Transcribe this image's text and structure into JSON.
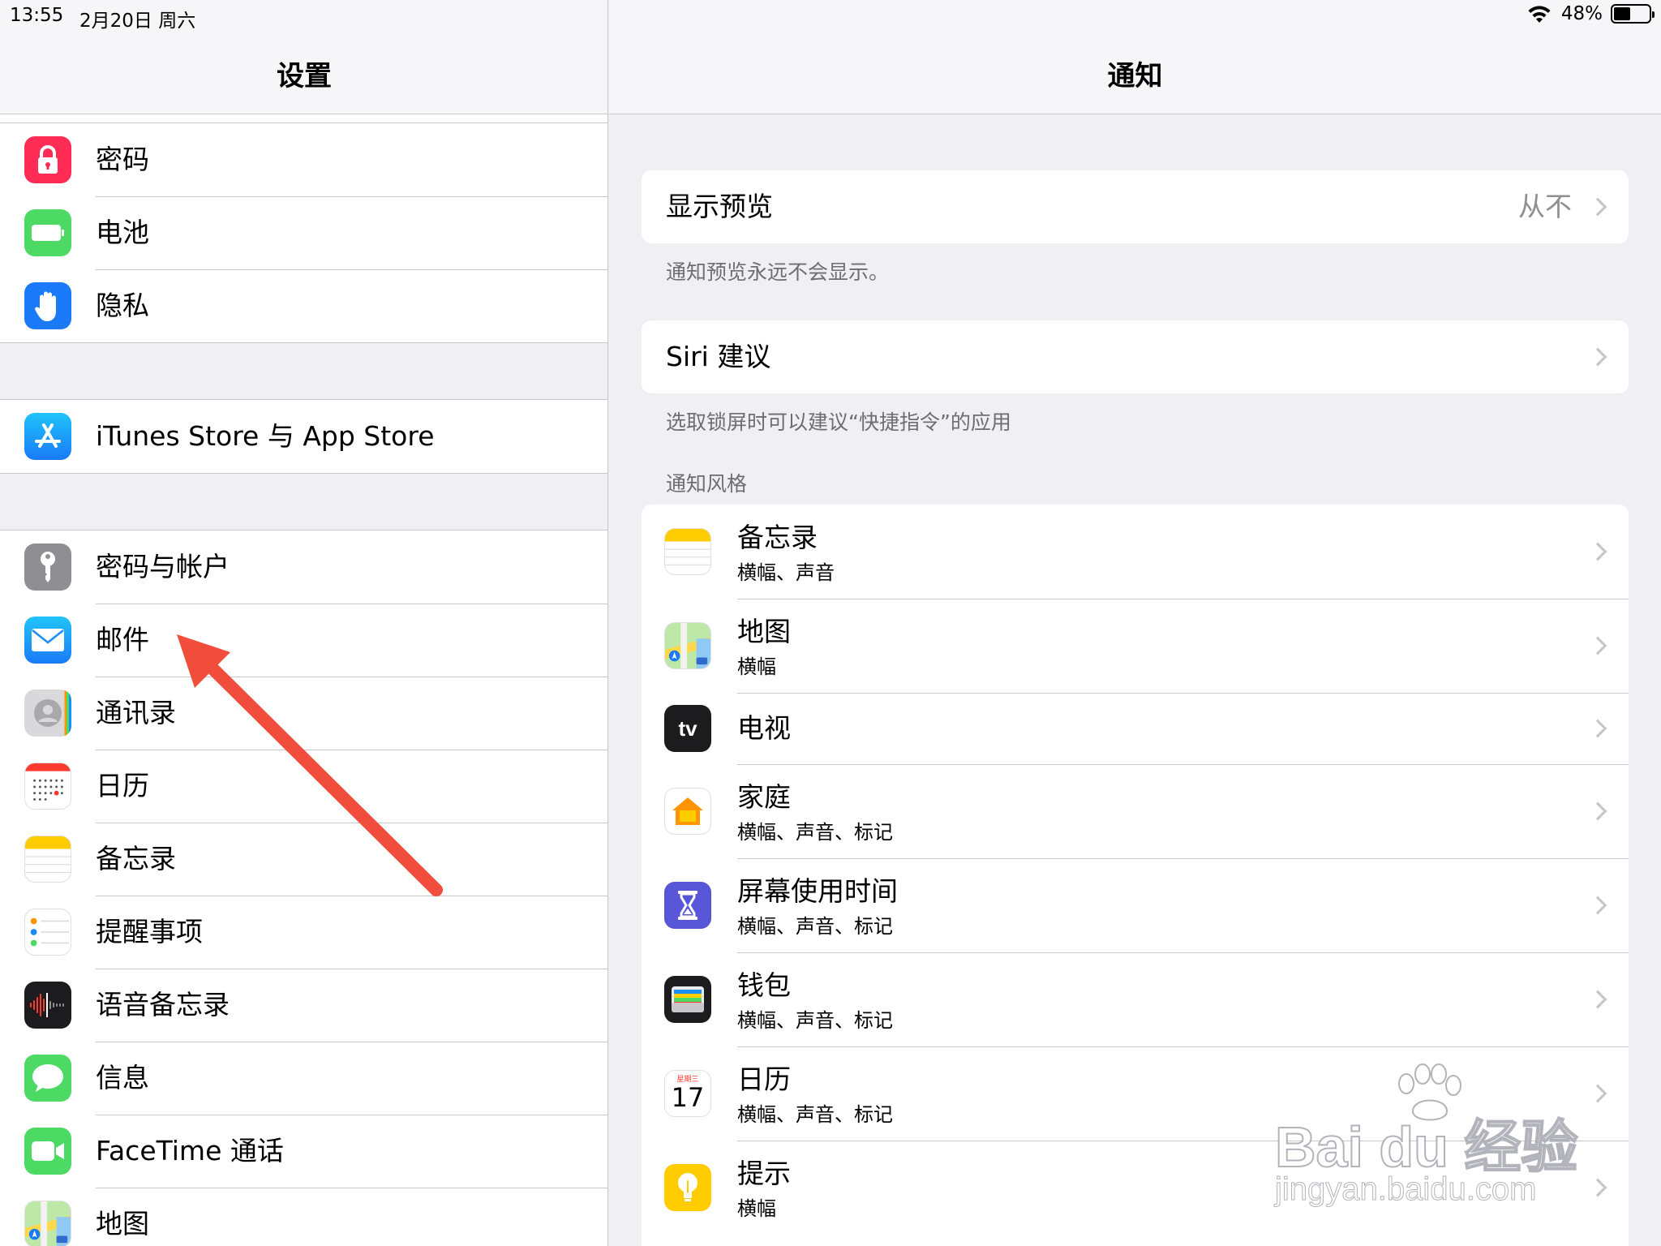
{
  "status_bar": {
    "time": "13:55",
    "date": "2月20日 周六",
    "battery": "48%",
    "battery_level": 0.48
  },
  "left": {
    "title": "设置",
    "groups": [
      [
        {
          "label": "密码",
          "icon": "lock-icon",
          "color": "#ff3b30"
        },
        {
          "label": "电池",
          "icon": "battery-icon",
          "color": "#4cd964"
        },
        {
          "label": "隐私",
          "icon": "hand-icon",
          "color": "#1a7af8"
        }
      ],
      [
        {
          "label": "iTunes Store 与 App Store",
          "icon": "app-store-icon",
          "color": "#1e9bf5"
        }
      ],
      [
        {
          "label": "密码与帐户",
          "icon": "key-icon",
          "color": "#8e8e93"
        },
        {
          "label": "邮件",
          "icon": "mail-icon",
          "color": "#1a8cf5"
        },
        {
          "label": "通讯录",
          "icon": "contacts-icon",
          "color": "#c7c7cc"
        },
        {
          "label": "日历",
          "icon": "calendar-icon",
          "color": "#ffffff"
        },
        {
          "label": "备忘录",
          "icon": "notes-icon",
          "color": "#ffffff"
        },
        {
          "label": "提醒事项",
          "icon": "reminders-icon",
          "color": "#ffffff"
        },
        {
          "label": "语音备忘录",
          "icon": "voice-memos-icon",
          "color": "#1c1c1e"
        },
        {
          "label": "信息",
          "icon": "messages-icon",
          "color": "#4cd964"
        },
        {
          "label": "FaceTime 通话",
          "icon": "facetime-icon",
          "color": "#4cd964"
        },
        {
          "label": "地图",
          "icon": "maps-icon",
          "color": "#ffffff"
        }
      ]
    ]
  },
  "right": {
    "title": "通知",
    "preview": {
      "label": "显示预览",
      "value": "从不",
      "note": "通知预览永远不会显示。"
    },
    "siri": {
      "label": "Siri 建议",
      "note": "选取锁屏时可以建议“快捷指令”的应用"
    },
    "style_header": "通知风格",
    "apps": [
      {
        "name": "备忘录",
        "sub": "横幅、声音",
        "icon": "notes-icon"
      },
      {
        "name": "地图",
        "sub": "横幅",
        "icon": "maps-icon"
      },
      {
        "name": "电视",
        "sub": "",
        "icon": "tv-icon",
        "icon_text": "tv"
      },
      {
        "name": "家庭",
        "sub": "横幅、声音、标记",
        "icon": "home-icon"
      },
      {
        "name": "屏幕使用时间",
        "sub": "横幅、声音、标记",
        "icon": "hourglass-icon"
      },
      {
        "name": "钱包",
        "sub": "横幅、声音、标记",
        "icon": "wallet-icon"
      },
      {
        "name": "日历",
        "sub": "横幅、声音、标记",
        "icon": "calendar-icon",
        "icon_day": "星期三",
        "icon_date": "17"
      },
      {
        "name": "提示",
        "sub": "横幅",
        "icon": "tips-icon"
      }
    ]
  },
  "watermark": {
    "main": "Bai du 经验",
    "url": "jingyan.baidu.com"
  }
}
